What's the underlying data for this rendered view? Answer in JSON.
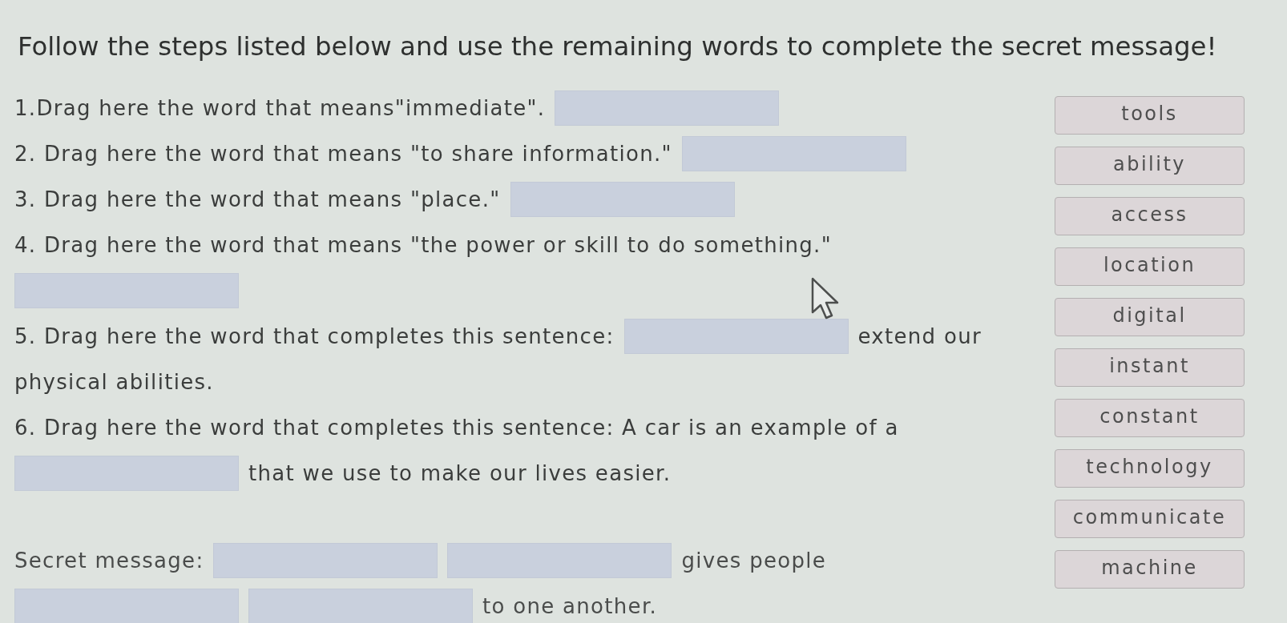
{
  "title": "Follow the steps listed below and use the remaining words to complete the secret message!",
  "steps": [
    {
      "lines": [
        [
          {
            "kind": "text",
            "text": "1.Drag here the word that means\"immediate\"."
          },
          {
            "kind": "blank"
          }
        ]
      ]
    },
    {
      "lines": [
        [
          {
            "kind": "text",
            "text": "2. Drag here the word that means \"to share information.\""
          },
          {
            "kind": "blank"
          }
        ]
      ]
    },
    {
      "lines": [
        [
          {
            "kind": "text",
            "text": "3. Drag here the word that means \"place.\""
          },
          {
            "kind": "blank"
          }
        ]
      ]
    },
    {
      "lines": [
        [
          {
            "kind": "text",
            "text": "4. Drag here the word that means \"the power or skill to do something.\""
          }
        ],
        [
          {
            "kind": "blank"
          }
        ]
      ]
    },
    {
      "lines": [
        [
          {
            "kind": "text",
            "text": "5. Drag here the word that completes this sentence:"
          },
          {
            "kind": "blank"
          },
          {
            "kind": "text",
            "text": "extend our"
          }
        ],
        [
          {
            "kind": "text",
            "text": "physical abilities."
          }
        ]
      ]
    },
    {
      "lines": [
        [
          {
            "kind": "text",
            "text": "6. Drag here the word that completes this sentence: A car is an example of a"
          }
        ],
        [
          {
            "kind": "blank"
          },
          {
            "kind": "text",
            "text": "that we use to make our lives easier."
          }
        ]
      ]
    }
  ],
  "secret_message": {
    "lines": [
      [
        {
          "kind": "text",
          "text": "Secret message:"
        },
        {
          "kind": "blank"
        },
        {
          "kind": "blank"
        },
        {
          "kind": "text",
          "text": "gives people"
        }
      ],
      [
        {
          "kind": "blank"
        },
        {
          "kind": "blank"
        },
        {
          "kind": "text",
          "text": "to one another."
        }
      ]
    ]
  },
  "word_bank": [
    "tools",
    "ability",
    "access",
    "location",
    "digital",
    "instant",
    "constant",
    "technology",
    "communicate",
    "machine"
  ]
}
